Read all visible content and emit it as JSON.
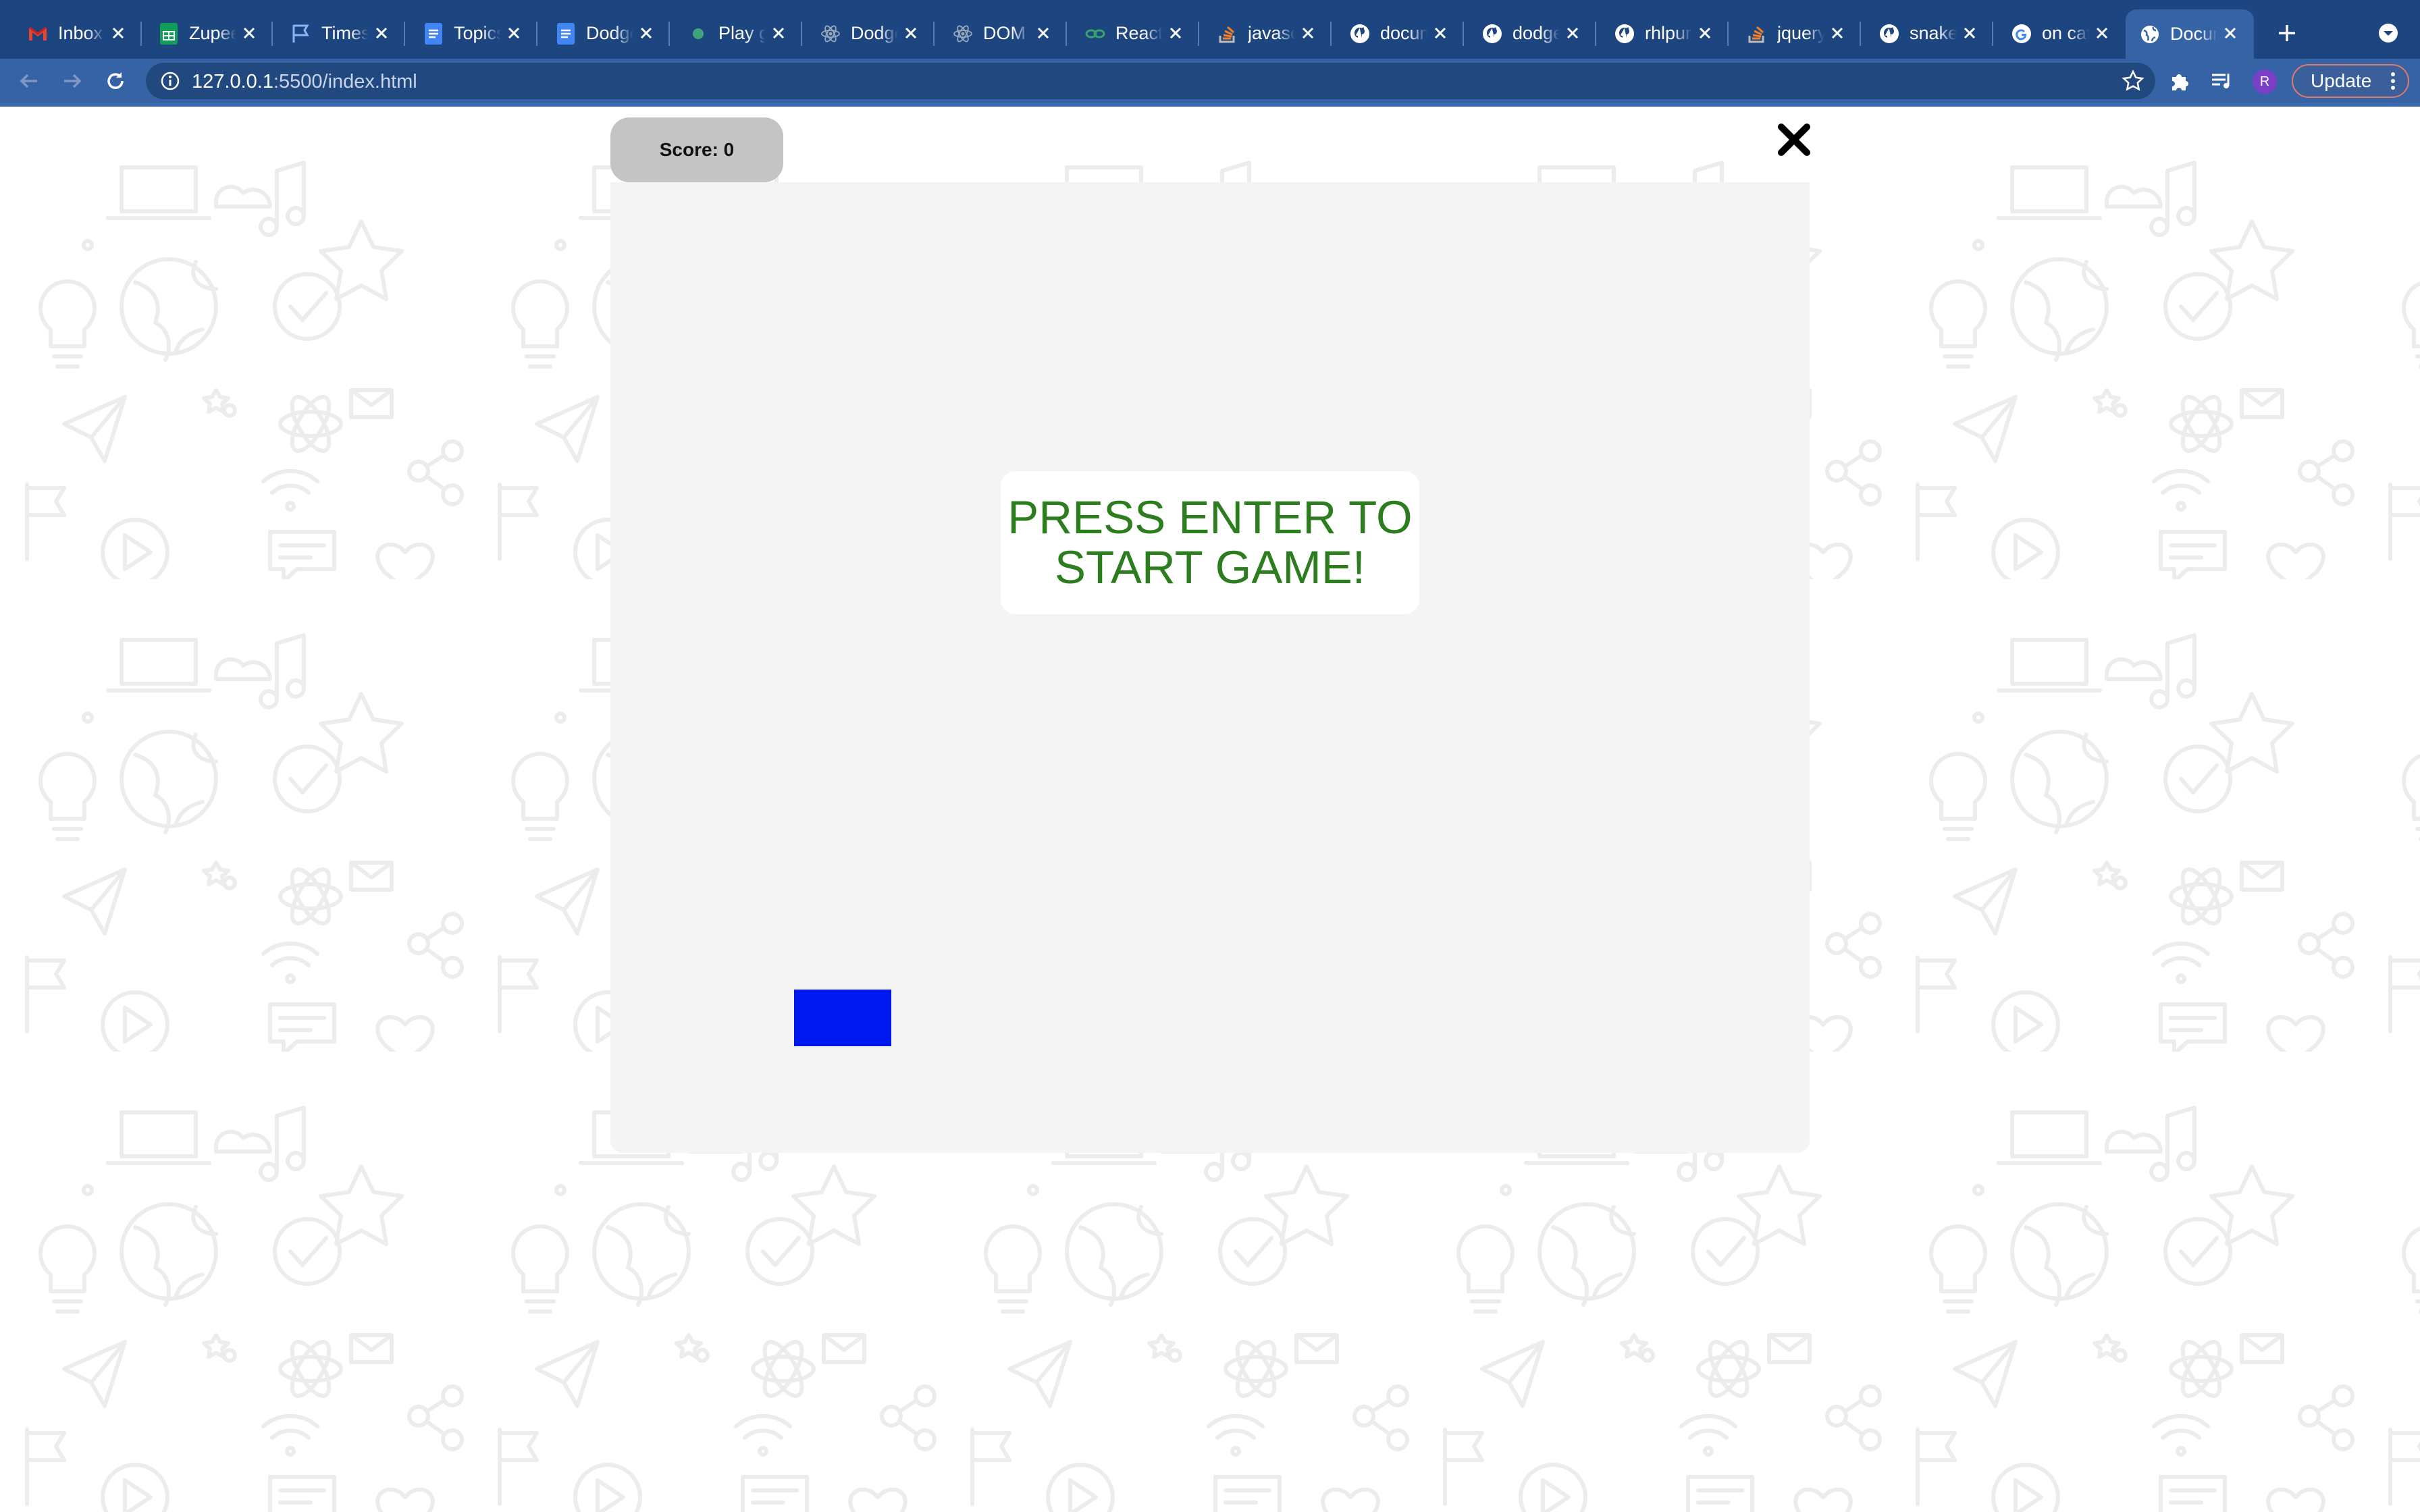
{
  "browser": {
    "tabs": [
      {
        "title": "Inbox",
        "icon": "gmail-icon",
        "active": false
      },
      {
        "title": "Zupee",
        "icon": "sheets-icon",
        "active": false
      },
      {
        "title": "Timesheet",
        "icon": "flag-icon",
        "active": false
      },
      {
        "title": "Topics",
        "icon": "docs-icon",
        "active": false
      },
      {
        "title": "Dodge",
        "icon": "docs-icon",
        "active": false
      },
      {
        "title": "Play game",
        "icon": "dot-icon",
        "active": false
      },
      {
        "title": "Dodge",
        "icon": "react-icon",
        "active": false
      },
      {
        "title": "DOM",
        "icon": "react-icon",
        "active": false
      },
      {
        "title": "React",
        "icon": "link-icon",
        "active": false
      },
      {
        "title": "javascript",
        "icon": "stackoverflow-icon",
        "active": false
      },
      {
        "title": "document",
        "icon": "github-icon",
        "active": false
      },
      {
        "title": "dodge",
        "icon": "github-icon",
        "active": false
      },
      {
        "title": "rhlpur",
        "icon": "github-icon",
        "active": false
      },
      {
        "title": "jquery",
        "icon": "stackoverflow-icon",
        "active": false
      },
      {
        "title": "snake",
        "icon": "github-icon",
        "active": false
      },
      {
        "title": "on cat",
        "icon": "google-icon",
        "active": false
      },
      {
        "title": "Document",
        "icon": "globe-icon",
        "active": true
      }
    ],
    "url_host": "127.0.0.1",
    "url_path": ":5500/index.html",
    "update_label": "Update",
    "avatar_initial": "R",
    "accent_color": "#3563a6",
    "frame_color": "#1d4580"
  },
  "game": {
    "score_text": "Score: 0",
    "start_line1": "PRESS ENTER TO",
    "start_line2": "START GAME!",
    "message_color": "#2b7d1e",
    "player_color": "#0018f0"
  }
}
